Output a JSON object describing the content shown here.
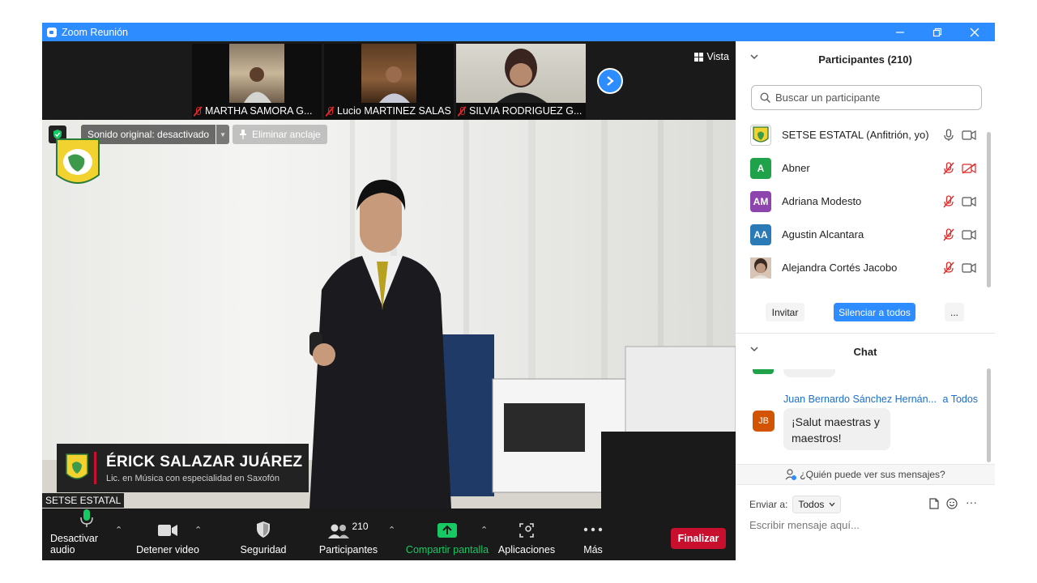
{
  "window": {
    "title": "Zoom Reunión"
  },
  "thumbnails": [
    {
      "name": "MARTHA SAMORA G..."
    },
    {
      "name": "Lucio MARTINEZ SALAS"
    },
    {
      "name": "SILVIA RODRIGUEZ G..."
    }
  ],
  "view_button": "Vista",
  "main_video": {
    "audio_status": "Sonido original: desactivado",
    "unpin_label": "Eliminar anclaje",
    "speaker_name": "ÉRICK SALAZAR JUÁREZ",
    "speaker_subtitle": "Lic. en Música con especialidad en Saxofón",
    "self_label": "SETSE ESTATAL"
  },
  "toolbar": {
    "mute_label": "Desactivar audio",
    "video_label": "Detener video",
    "security_label": "Seguridad",
    "participants_label": "Participantes",
    "participants_count": "210",
    "share_label": "Compartir pantalla",
    "apps_label": "Aplicaciones",
    "more_label": "Más",
    "end_label": "Finalizar"
  },
  "participants_panel": {
    "title": "Participantes (210)",
    "search_placeholder": "Buscar un participante",
    "items": [
      {
        "name": "SETSE ESTATAL (Anfitrión, yo)",
        "initials": "",
        "color": "#ffffff",
        "mic": "on",
        "cam": "on"
      },
      {
        "name": "Abner",
        "initials": "A",
        "color": "#1fa24a",
        "mic": "muted",
        "cam": "off"
      },
      {
        "name": "Adriana Modesto",
        "initials": "AM",
        "color": "#8e44ad",
        "mic": "muted",
        "cam": "on"
      },
      {
        "name": "Agustin Alcantara",
        "initials": "AA",
        "color": "#2a7ab8",
        "mic": "muted",
        "cam": "on"
      },
      {
        "name": "Alejandra Cortés Jacobo",
        "initials": "",
        "color": "#b08a70",
        "mic": "muted",
        "cam": "on"
      }
    ],
    "invite_label": "Invitar",
    "mute_all_label": "Silenciar a todos",
    "more_label": "..."
  },
  "chat_panel": {
    "title": "Chat",
    "message": {
      "sender": "Juan Bernardo Sánchez Hernán...",
      "to": "a Todos",
      "initials": "JB",
      "avatar_color": "#d35400",
      "line1": "¡Salut maestras y",
      "line2": "maestros!"
    },
    "who_sees": "¿Quién puede ver sus mensajes?",
    "send_to_label": "Enviar a:",
    "send_to_value": "Todos",
    "input_placeholder": "Escribir mensaje aquí...",
    "more_icon": "···"
  },
  "colors": {
    "accent": "#2d8cff",
    "end": "#c8102e",
    "share": "#17c964",
    "muted": "#e02828"
  }
}
